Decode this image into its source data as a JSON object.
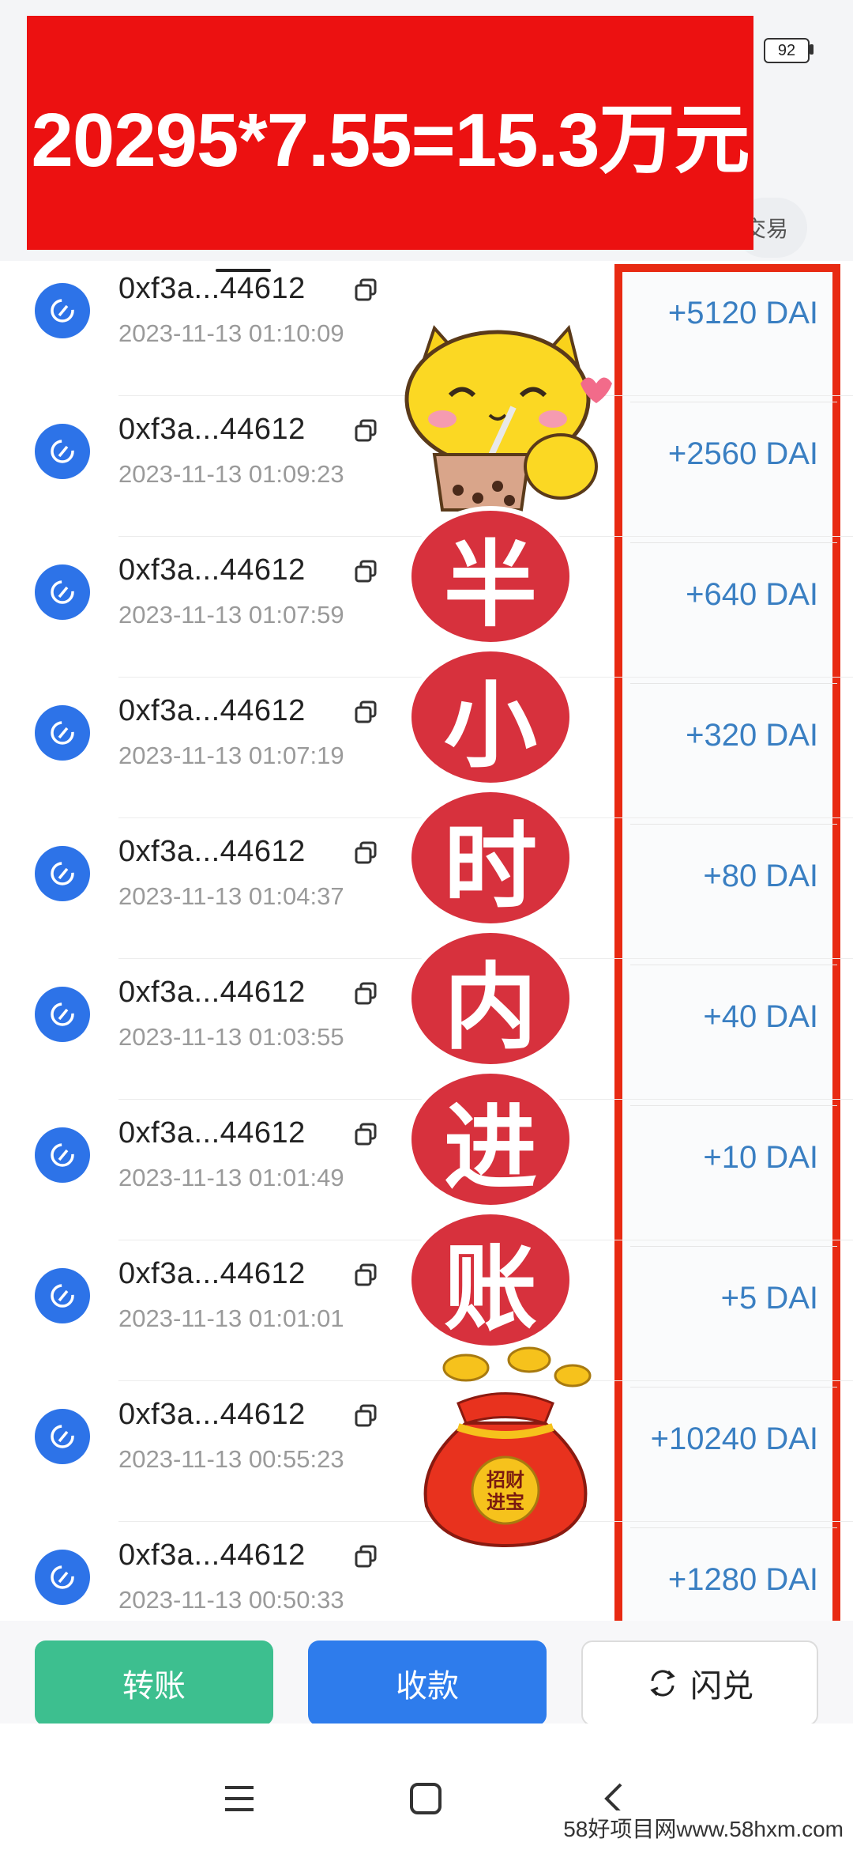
{
  "status_bar": {
    "battery": "92"
  },
  "banner": {
    "text": "20295*7.55=15.3万元"
  },
  "header": {
    "trade_label": "交易"
  },
  "transactions": [
    {
      "address": "0xf3a...44612",
      "time": "2023-11-13 01:10:09",
      "amount": "+5120 DAI"
    },
    {
      "address": "0xf3a...44612",
      "time": "2023-11-13 01:09:23",
      "amount": "+2560 DAI"
    },
    {
      "address": "0xf3a...44612",
      "time": "2023-11-13 01:07:59",
      "amount": "+640 DAI"
    },
    {
      "address": "0xf3a...44612",
      "time": "2023-11-13 01:07:19",
      "amount": "+320 DAI"
    },
    {
      "address": "0xf3a...44612",
      "time": "2023-11-13 01:04:37",
      "amount": "+80 DAI"
    },
    {
      "address": "0xf3a...44612",
      "time": "2023-11-13 01:03:55",
      "amount": "+40 DAI"
    },
    {
      "address": "0xf3a...44612",
      "time": "2023-11-13 01:01:49",
      "amount": "+10 DAI"
    },
    {
      "address": "0xf3a...44612",
      "time": "2023-11-13 01:01:01",
      "amount": "+5 DAI"
    },
    {
      "address": "0xf3a...44612",
      "time": "2023-11-13 00:55:23",
      "amount": "+10240 DAI"
    },
    {
      "address": "0xf3a...44612",
      "time": "2023-11-13 00:50:33",
      "amount": "+1280 DAI"
    }
  ],
  "overlay": {
    "vertical_chars": [
      "半",
      "小",
      "时",
      "内",
      "进",
      "账"
    ],
    "bag_text": "招财进宝"
  },
  "actions": {
    "transfer": "转账",
    "receive": "收款",
    "swap": "闪兑"
  },
  "watermark": "58好项目网www.58hxm.com",
  "colors": {
    "banner": "#ec1111",
    "amount": "#3a7fc2",
    "highlight_border": "#e82a12",
    "icon": "#2d73e8"
  }
}
